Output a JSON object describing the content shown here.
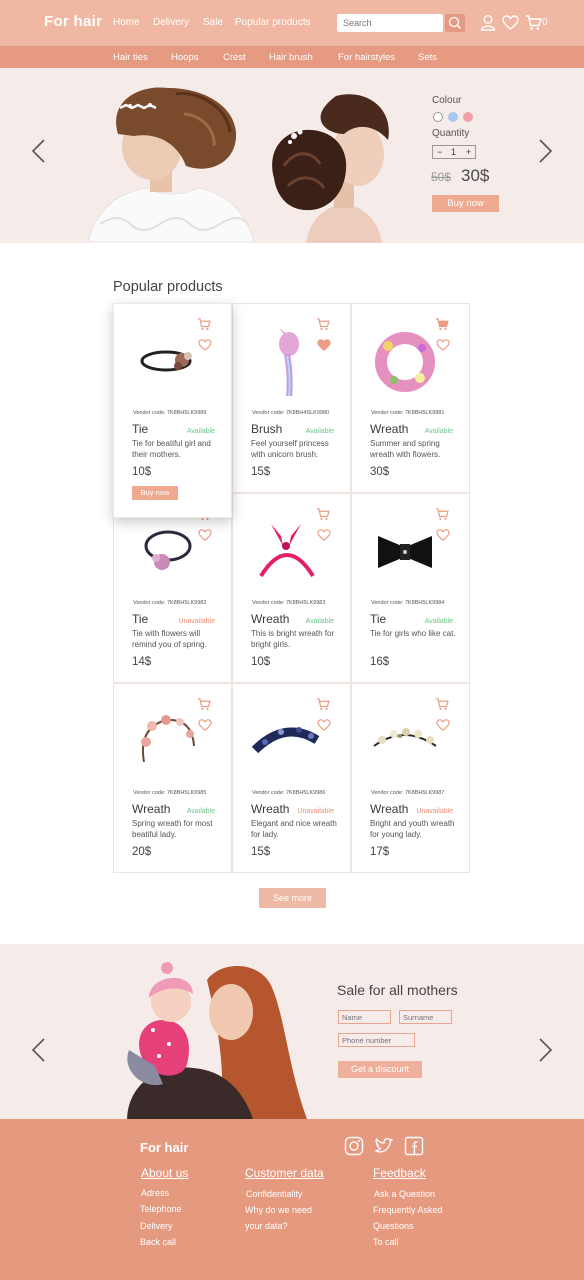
{
  "brand": {
    "logo": "For hair"
  },
  "nav": [
    "Home",
    "Delivery",
    "Sale",
    "Popular products"
  ],
  "search": {
    "placeholder": "Search"
  },
  "header": {
    "cart_count": "0"
  },
  "categories": [
    "Hair ties",
    "Hoops",
    "Crest",
    "Hair brush",
    "For hairstyles",
    "Sets"
  ],
  "hero": {
    "colour_label": "Colour",
    "quantity_label": "Quantity",
    "quantity_value": "1",
    "old_price": "50$",
    "new_price": "30$",
    "buy_label": "Buy now",
    "swatches": [
      "#ffffff",
      "#a9c6f0",
      "#f0a0a8"
    ]
  },
  "popular": {
    "title": "Popular products",
    "products": [
      {
        "vendor": "Vendor code: 7K8BH5LK9989",
        "name": "Tie",
        "status": "Available",
        "desc": "Tie for beatiful girl and their mothers.",
        "price": "10$",
        "buy": "Buy now"
      },
      {
        "vendor": "Vendor code: 7K8BH4SLK9980",
        "name": "Brush",
        "status": "Available",
        "desc": "Feel yourself princess with unicorn brush.",
        "price": "15$"
      },
      {
        "vendor": "Vendor code: 7K8BH5LK9981",
        "name": "Wreath",
        "status": "Available",
        "desc": "Summer and spring wreath with flowers.",
        "price": "30$"
      },
      {
        "vendor": "Vendor code: 7K8BH5LK9982",
        "name": "Tie",
        "status": "Unavailable",
        "desc": "Tie with flowers will remind you of spring.",
        "price": "14$"
      },
      {
        "vendor": "Vendor code: 7K8BH5LK9983",
        "name": "Wreath",
        "status": "Available",
        "desc": "This is bright wreath for bright girls.",
        "price": "10$"
      },
      {
        "vendor": "Vendor code: 7K8BH5LK9984",
        "name": "Tie",
        "status": "Available",
        "desc": "Tie for girls who like cat.",
        "price": "16$"
      },
      {
        "vendor": "Vendor code: 7K8BH5LK9985",
        "name": "Wreath",
        "status": "Available",
        "desc": "Spring wreath for most beatiful lady.",
        "price": "20$"
      },
      {
        "vendor": "Vendor code: 7K8BH5LK9986",
        "name": "Wreath",
        "status": "Unavailable",
        "desc": "Elegant and nice wreath for lady.",
        "price": "15$"
      },
      {
        "vendor": "Vendor code: 7K8BH5LK9987",
        "name": "Wreath",
        "status": "Unavailable",
        "desc": "Bright and youth wreath for young lady.",
        "price": "17$"
      }
    ],
    "see_more": "See more"
  },
  "sale": {
    "title": "Sale for all mothers",
    "name_placeholder": "Name",
    "surname_placeholder": "Surname",
    "phone_placeholder": "Phone number",
    "button": "Get a discount"
  },
  "footer": {
    "logo": "For hair",
    "about": {
      "title": "About us",
      "links": [
        "Adress",
        "Telephone",
        "Delivery",
        "Back call"
      ]
    },
    "customer": {
      "title": "Customer data",
      "links": [
        "Confidentiality",
        "Why do we need",
        "your data?"
      ]
    },
    "feedback": {
      "title": "Feedback",
      "links": [
        "Ask a Question",
        "Frequently Asked",
        "Questions",
        "To call"
      ]
    }
  },
  "colors": {
    "header": "#f0b8a2",
    "catbar": "#e59a81",
    "footer": "#e59a80",
    "available": "#6cc58a",
    "unavailable": "#ef8f78",
    "hero_bg": "#f5ecea"
  }
}
